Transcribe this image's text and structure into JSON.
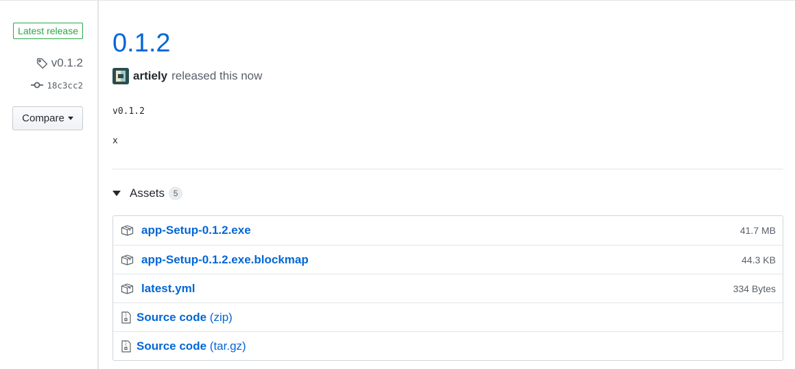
{
  "sidebar": {
    "latest_badge": "Latest release",
    "tag": "v0.1.2",
    "commit": "18c3cc2",
    "compare_label": "Compare"
  },
  "release": {
    "title": "0.1.2",
    "author": "artiely",
    "released_text": "released this now",
    "body_lines": [
      "v0.1.2",
      "x"
    ]
  },
  "assets": {
    "title": "Assets",
    "count": "5",
    "files": [
      {
        "name": "app-Setup-0.1.2.exe",
        "size": "41.7 MB",
        "icon": "package-icon"
      },
      {
        "name": "app-Setup-0.1.2.exe.blockmap",
        "size": "44.3 KB",
        "icon": "package-icon"
      },
      {
        "name": "latest.yml",
        "size": "334 Bytes",
        "icon": "package-icon"
      }
    ],
    "sources": [
      {
        "label": "Source code",
        "format": "(zip)",
        "icon": "file-zip-icon"
      },
      {
        "label": "Source code",
        "format": "(tar.gz)",
        "icon": "file-zip-icon"
      }
    ]
  },
  "colors": {
    "link": "#0366d6",
    "latest_green": "#28a745",
    "muted": "#586069",
    "border": "#e1e4e8"
  }
}
